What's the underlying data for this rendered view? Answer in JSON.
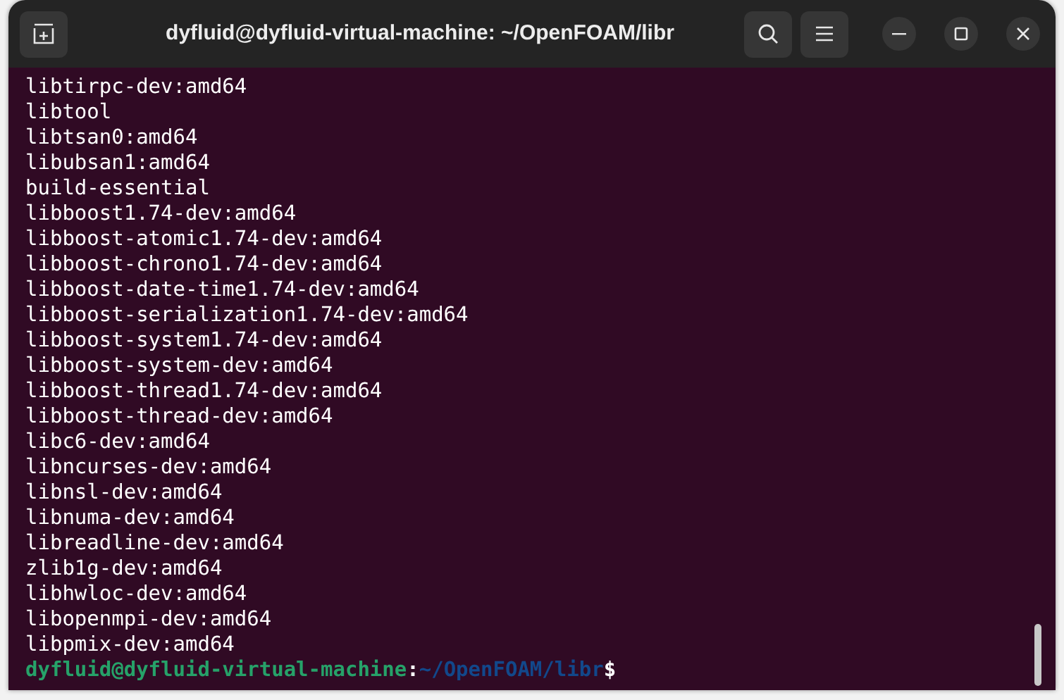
{
  "window": {
    "title": "dyfluid@dyfluid-virtual-machine: ~/OpenFOAM/libr"
  },
  "terminal": {
    "lines": [
      "libtirpc-dev:amd64",
      "libtool",
      "libtsan0:amd64",
      "libubsan1:amd64",
      "build-essential",
      "libboost1.74-dev:amd64",
      "libboost-atomic1.74-dev:amd64",
      "libboost-chrono1.74-dev:amd64",
      "libboost-date-time1.74-dev:amd64",
      "libboost-serialization1.74-dev:amd64",
      "libboost-system1.74-dev:amd64",
      "libboost-system-dev:amd64",
      "libboost-thread1.74-dev:amd64",
      "libboost-thread-dev:amd64",
      "libc6-dev:amd64",
      "libncurses-dev:amd64",
      "libnsl-dev:amd64",
      "libnuma-dev:amd64",
      "libreadline-dev:amd64",
      "zlib1g-dev:amd64",
      "libhwloc-dev:amd64",
      "libopenmpi-dev:amd64",
      "libpmix-dev:amd64"
    ],
    "prompt": {
      "user_host": "dyfluid@dyfluid-virtual-machine",
      "separator": ":",
      "path": "~/OpenFOAM/libr",
      "symbol": "$"
    }
  }
}
